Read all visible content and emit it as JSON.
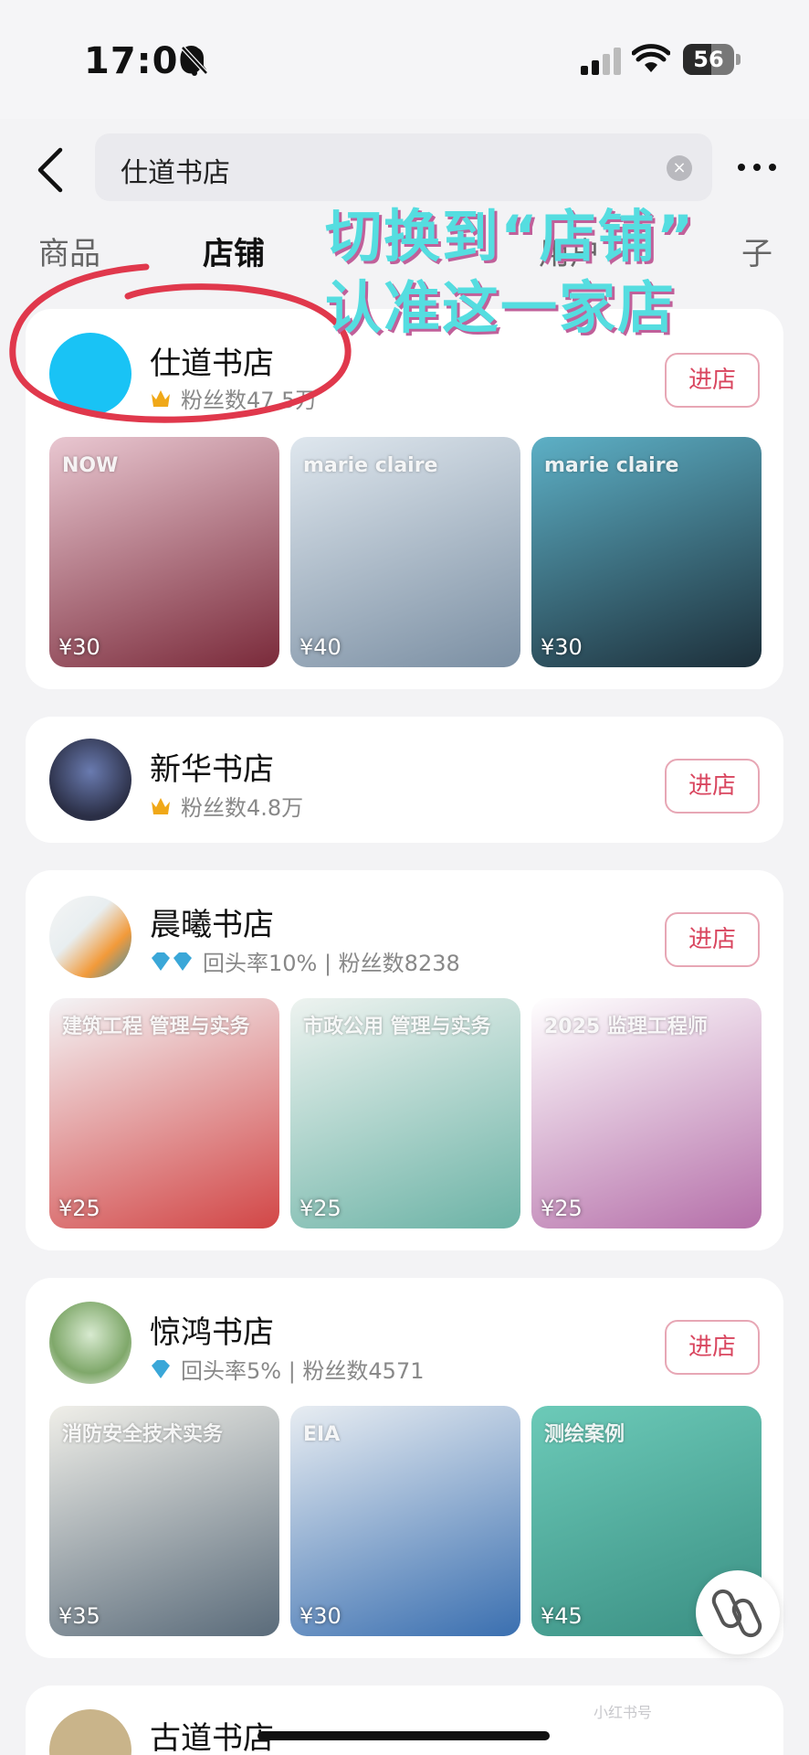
{
  "status_bar": {
    "time": "17:00",
    "battery": "56",
    "battery_level": 0.56
  },
  "search": {
    "query": "仕道书店",
    "clear_glyph": "×"
  },
  "tabs": [
    "商品",
    "店铺",
    "用户",
    "子"
  ],
  "annotation": {
    "line1": "切换到“店铺”",
    "line2": "认准这一家店"
  },
  "enter_label": "进店",
  "stores": [
    {
      "name": "仕道书店",
      "meta": "粉丝数47.5万",
      "badge": "crown-icon",
      "products": [
        {
          "price": "¥30",
          "cover_text": "NOW",
          "colors": [
            "#e9c7d1",
            "#7a2a3a"
          ]
        },
        {
          "price": "¥40",
          "cover_text": "marie claire",
          "colors": [
            "#dfe7ee",
            "#7b8fa3"
          ]
        },
        {
          "price": "¥30",
          "cover_text": "marie claire",
          "colors": [
            "#5db0c6",
            "#1d2f3a"
          ]
        }
      ]
    },
    {
      "name": "新华书店",
      "meta": "粉丝数4.8万",
      "badge": "crown-icon"
    },
    {
      "name": "晨曦书店",
      "meta": "回头率10% | 粉丝数8238",
      "badge": "diamond-icon",
      "products": [
        {
          "price": "¥25",
          "cover_text": "建筑工程 管理与实务",
          "colors": [
            "#f4f4f6",
            "#d24646"
          ]
        },
        {
          "price": "¥25",
          "cover_text": "市政公用 管理与实务",
          "colors": [
            "#eef3f0",
            "#6cb3a6"
          ]
        },
        {
          "price": "¥25",
          "cover_text": "2025 监理工程师",
          "colors": [
            "#ffffff",
            "#b56fa9"
          ]
        }
      ]
    },
    {
      "name": "惊鸿书店",
      "meta": "回头率5% | 粉丝数4571",
      "badge": "diamond-icon",
      "products": [
        {
          "price": "¥35",
          "cover_text": "消防安全技术实务",
          "colors": [
            "#f0efe9",
            "#5a6b7a"
          ]
        },
        {
          "price": "¥30",
          "cover_text": "EIA",
          "colors": [
            "#e8edf2",
            "#3a6fb0"
          ]
        },
        {
          "price": "¥45",
          "cover_text": "测绘案例",
          "colors": [
            "#6ccab8",
            "#3a8f83"
          ]
        }
      ]
    },
    {
      "name": "古道书店"
    }
  ],
  "watermark": "小红书号"
}
